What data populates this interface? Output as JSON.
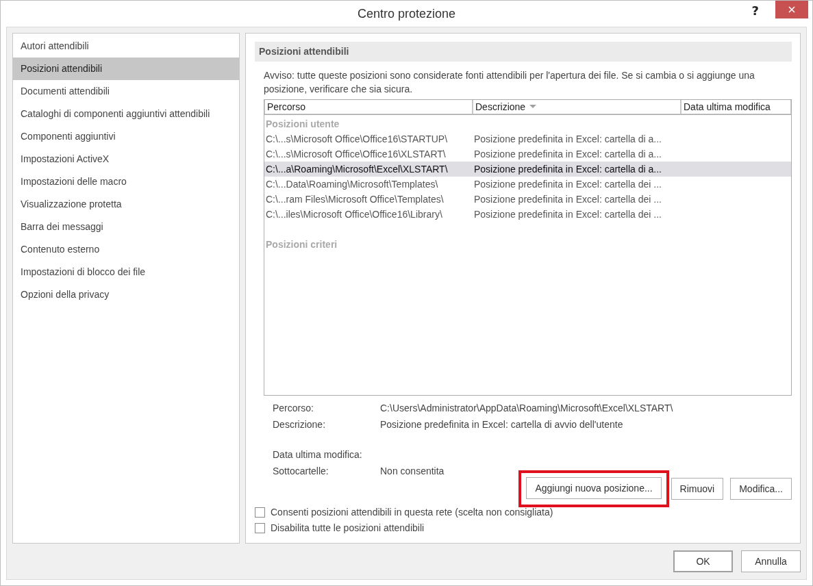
{
  "window": {
    "title": "Centro protezione",
    "help": "?"
  },
  "sidebar": {
    "items": [
      {
        "label": "Autori attendibili",
        "selected": false
      },
      {
        "label": "Posizioni attendibili",
        "selected": true
      },
      {
        "label": "Documenti attendibili",
        "selected": false
      },
      {
        "label": "Cataloghi di componenti aggiuntivi attendibili",
        "selected": false
      },
      {
        "label": "Componenti aggiuntivi",
        "selected": false
      },
      {
        "label": "Impostazioni ActiveX",
        "selected": false
      },
      {
        "label": "Impostazioni delle macro",
        "selected": false
      },
      {
        "label": "Visualizzazione protetta",
        "selected": false
      },
      {
        "label": "Barra dei messaggi",
        "selected": false
      },
      {
        "label": "Contenuto esterno",
        "selected": false
      },
      {
        "label": "Impostazioni di blocco dei file",
        "selected": false
      },
      {
        "label": "Opzioni della privacy",
        "selected": false
      }
    ]
  },
  "section_title": "Posizioni attendibili",
  "warning": "Avviso: tutte queste posizioni sono considerate fonti attendibili per l'apertura dei file. Se si cambia o si aggiunge una posizione, verificare che sia sicura.",
  "table": {
    "columns": [
      {
        "label": "Percorso",
        "sorted": false
      },
      {
        "label": "Descrizione",
        "sorted": true
      },
      {
        "label": "Data ultima modifica",
        "sorted": false
      }
    ],
    "groups": [
      {
        "label": "Posizioni utente",
        "rows": [
          {
            "path": "C:\\...s\\Microsoft Office\\Office16\\STARTUP\\",
            "description": "Posizione predefinita in Excel: cartella di a...",
            "selected": false
          },
          {
            "path": "C:\\...s\\Microsoft Office\\Office16\\XLSTART\\",
            "description": "Posizione predefinita in Excel: cartella di a...",
            "selected": false
          },
          {
            "path": "C:\\...a\\Roaming\\Microsoft\\Excel\\XLSTART\\",
            "description": "Posizione predefinita in Excel: cartella di a...",
            "selected": true
          },
          {
            "path": "C:\\...Data\\Roaming\\Microsoft\\Templates\\",
            "description": "Posizione predefinita in Excel: cartella dei ...",
            "selected": false
          },
          {
            "path": "C:\\...ram Files\\Microsoft Office\\Templates\\",
            "description": "Posizione predefinita in Excel: cartella dei ...",
            "selected": false
          },
          {
            "path": "C:\\...iles\\Microsoft Office\\Office16\\Library\\",
            "description": "Posizione predefinita in Excel: cartella dei ...",
            "selected": false
          }
        ]
      },
      {
        "label": "Posizioni criteri"
      }
    ]
  },
  "details": [
    [
      {
        "label": "Percorso:",
        "value": "C:\\Users\\Administrator\\AppData\\Roaming\\Microsoft\\Excel\\XLSTART\\"
      },
      {
        "label": "Descrizione:",
        "value": "Posizione predefinita in Excel: cartella di avvio dell'utente"
      }
    ],
    [
      {
        "label": "Data ultima modifica:"
      },
      {
        "label": "Sottocartelle:",
        "value": "Non consentita"
      }
    ]
  ],
  "buttons": [
    {
      "label": "Aggiungi nuova posizione...",
      "highlighted": true
    },
    {
      "label": "Rimuovi",
      "highlighted": false
    },
    {
      "label": "Modifica...",
      "highlighted": false
    }
  ],
  "checkboxes": [
    {
      "label": "Consenti posizioni attendibili in questa rete (scelta non consigliata)",
      "checked": false
    },
    {
      "label": "Disabilita tutte le posizioni attendibili",
      "checked": false
    }
  ],
  "footer_buttons": [
    {
      "label": "OK",
      "default": true
    },
    {
      "label": "Annulla",
      "default": false
    }
  ]
}
